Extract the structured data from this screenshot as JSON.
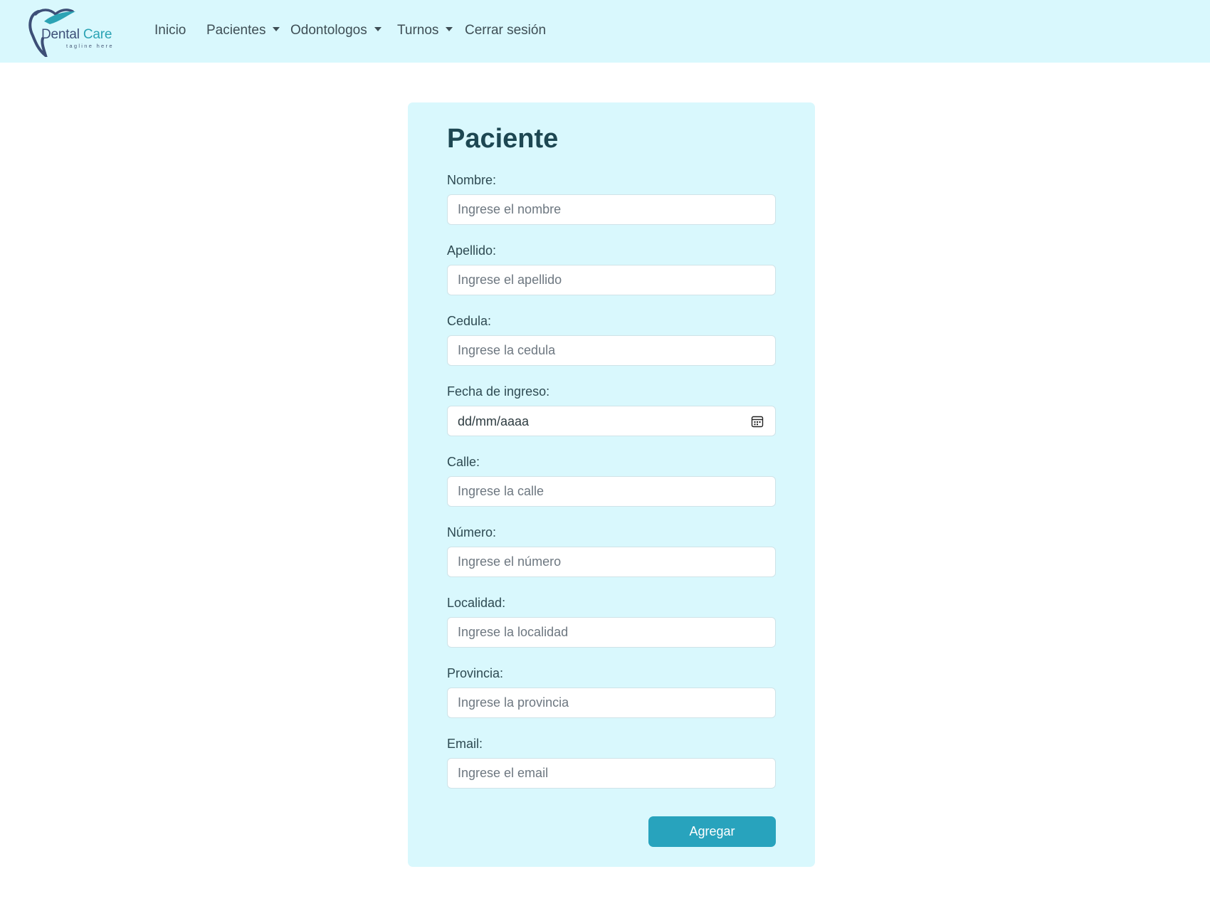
{
  "brand": {
    "name_part1": "Dental",
    "name_part2": "Care",
    "tagline": "tagline here",
    "colors": {
      "primary": "#3d4f77",
      "accent": "#2ba3b4"
    }
  },
  "nav": {
    "inicio": "Inicio",
    "pacientes": "Pacientes",
    "odontologos": "Odontologos",
    "turnos": "Turnos",
    "cerrar_sesion": "Cerrar sesión"
  },
  "form": {
    "title": "Paciente",
    "fields": {
      "nombre": {
        "label": "Nombre:",
        "placeholder": "Ingrese el nombre"
      },
      "apellido": {
        "label": "Apellido:",
        "placeholder": "Ingrese el apellido"
      },
      "cedula": {
        "label": "Cedula:",
        "placeholder": "Ingrese la cedula"
      },
      "fecha_ingreso": {
        "label": "Fecha de ingreso:",
        "value": "dd/mm/aaaa",
        "icon": "calendar-icon"
      },
      "calle": {
        "label": "Calle:",
        "placeholder": "Ingrese la calle"
      },
      "numero": {
        "label": "Número:",
        "placeholder": "Ingrese el número"
      },
      "localidad": {
        "label": "Localidad:",
        "placeholder": "Ingrese la localidad"
      },
      "provincia": {
        "label": "Provincia:",
        "placeholder": "Ingrese la provincia"
      },
      "email": {
        "label": "Email:",
        "placeholder": "Ingrese el email"
      }
    },
    "submit_label": "Agregar"
  },
  "colors": {
    "navbar_bg": "#d9f8fd",
    "card_bg": "#d9f8fd",
    "button_bg": "#28a3bd",
    "title": "#1d4752"
  }
}
